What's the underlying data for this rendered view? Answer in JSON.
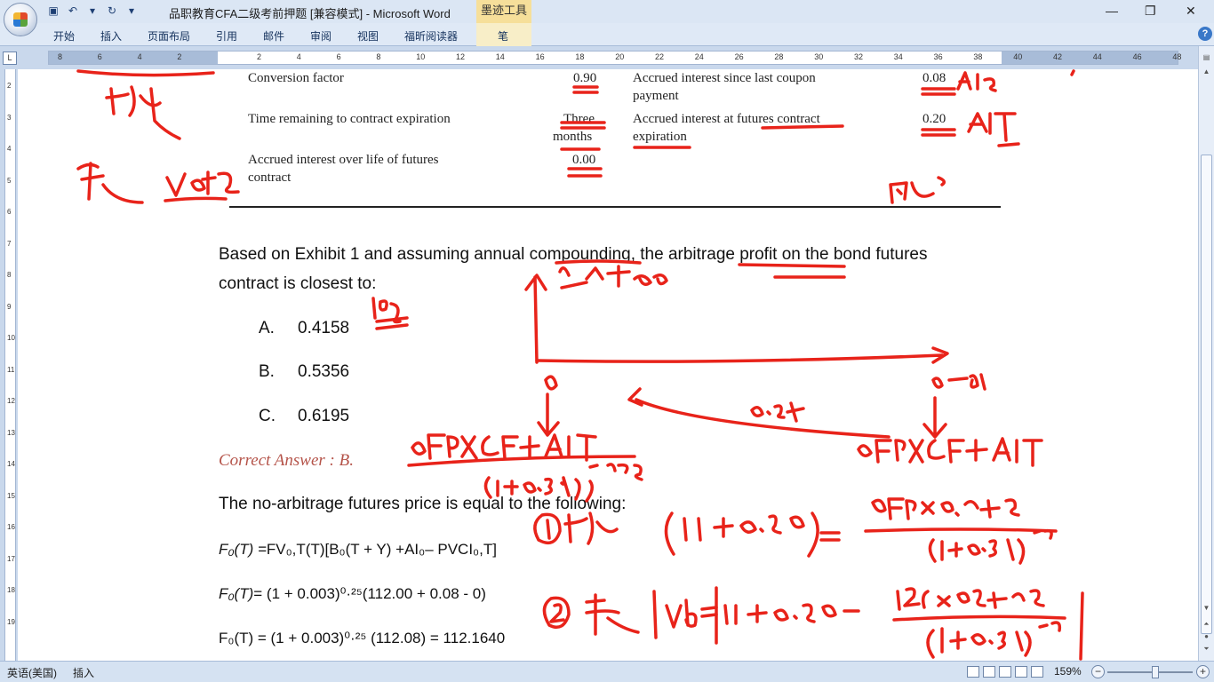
{
  "window": {
    "title": "品职教育CFA二级考前押题 [兼容模式] - Microsoft Word",
    "contextual_tab_group": "墨迹工具",
    "controls": [
      "minimize",
      "restore",
      "close"
    ]
  },
  "ribbon": {
    "tabs": [
      "开始",
      "插入",
      "页面布局",
      "引用",
      "邮件",
      "审阅",
      "视图",
      "福昕阅读器",
      "笔"
    ],
    "help": "?"
  },
  "ruler": {
    "corner": "L",
    "ticks": [
      "8",
      "6",
      "4",
      "2",
      "",
      "2",
      "4",
      "6",
      "8",
      "10",
      "12",
      "14",
      "16",
      "18",
      "20",
      "22",
      "24",
      "26",
      "28",
      "30",
      "32",
      "34",
      "36",
      "38",
      "40",
      "42",
      "44",
      "46",
      "48"
    ],
    "vticks": [
      "2",
      "3",
      "4",
      "5",
      "6",
      "7",
      "8",
      "9",
      "10",
      "11",
      "12",
      "13",
      "14",
      "15",
      "16",
      "17",
      "18",
      "19"
    ]
  },
  "exhibit": {
    "rows": [
      {
        "left_label": "Conversion factor",
        "left_value": "0.90",
        "right_label_1": "Accrued interest since last coupon",
        "right_label_2": "payment",
        "right_value": "0.08"
      },
      {
        "left_label": "Time remaining to contract expiration",
        "left_value_1": "Three",
        "left_value_2": "months",
        "right_label_1": "Accrued interest at futures contract",
        "right_label_2": "expiration",
        "right_value": "0.20"
      },
      {
        "left_label_1": "Accrued interest over life of futures",
        "left_label_2": "contract",
        "left_value": "0.00"
      }
    ]
  },
  "question": {
    "line1": "Based on Exhibit 1 and assuming annual compounding, the arbitrage profit on the bond futures",
    "line2": "contract is closest to:",
    "options": [
      {
        "letter": "A.",
        "value": "0.4158"
      },
      {
        "letter": "B.",
        "value": "0.5356"
      },
      {
        "letter": "C.",
        "value": "0.6195"
      }
    ],
    "correct_answer": "Correct Answer : B.",
    "explanation_intro": "The no-arbitrage futures price is equal to the following:",
    "formula1": {
      "lhs": "F₀(T) =",
      "rhs": "FV₀,T(T)[B₀(T + Y) +AI₀– PVCI₀,T]"
    },
    "formula2": {
      "lhs": "F₀(T)",
      "rhs": "= (1 + 0.003)⁰·²⁵(112.00 + 0.08 - 0)"
    },
    "formula3": "F₀(T) = (1 + 0.003)⁰·²⁵ (112.08) = 112.1640"
  },
  "statusbar": {
    "language": "英语(美国)",
    "mode": "插入",
    "zoom": "159%"
  },
  "ink_color": "#e8231a",
  "ui_colors": {
    "title_bg": "#dbe6f4",
    "ribbon_bg": "#dfe9f6",
    "ink_tab": "#f6df9a",
    "answer_color": "#b5544a"
  }
}
